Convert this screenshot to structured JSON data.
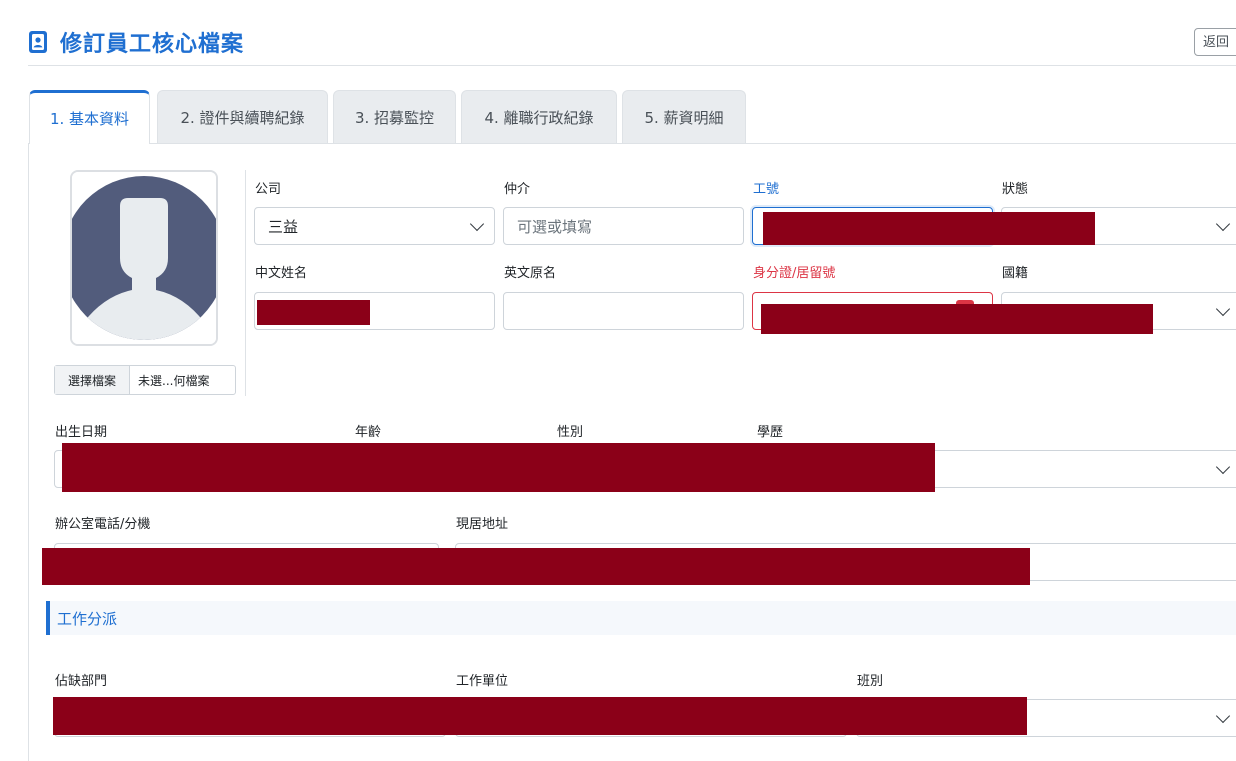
{
  "header": {
    "title": "修訂員工核心檔案",
    "back_label": "返回"
  },
  "tabs": [
    {
      "label": "1. 基本資料",
      "active": true
    },
    {
      "label": "2. 證件與續聘紀錄",
      "active": false
    },
    {
      "label": "3. 招募監控",
      "active": false
    },
    {
      "label": "4. 離職行政紀錄",
      "active": false
    },
    {
      "label": "5. 薪資明細",
      "active": false
    }
  ],
  "photo": {
    "choose_label": "選擇檔案",
    "file_status": "未選...何檔案"
  },
  "form": {
    "company": {
      "label": "公司",
      "value": "三益"
    },
    "agency": {
      "label": "仲介",
      "placeholder": "可選或填寫"
    },
    "employee_no": {
      "label": "工號"
    },
    "status": {
      "label": "狀態"
    },
    "chinese_name": {
      "label": "中文姓名"
    },
    "english_name": {
      "label": "英文原名"
    },
    "id_number": {
      "label": "身分證/居留號"
    },
    "nationality": {
      "label": "國籍"
    },
    "birth_date": {
      "label": "出生日期"
    },
    "age": {
      "label": "年齡"
    },
    "gender": {
      "label": "性別"
    },
    "education": {
      "label": "學歷"
    },
    "office_phone": {
      "label": "辦公室電話/分機"
    },
    "address": {
      "label": "現居地址"
    }
  },
  "assignment": {
    "section_title": "工作分派",
    "vacancy_dept": {
      "label": "佔缺部門"
    },
    "work_unit": {
      "label": "工作單位"
    },
    "shift": {
      "label": "班別"
    }
  },
  "colors": {
    "accent": "#1f6fd1",
    "redaction": "#8b0018",
    "error": "#dc3545"
  }
}
